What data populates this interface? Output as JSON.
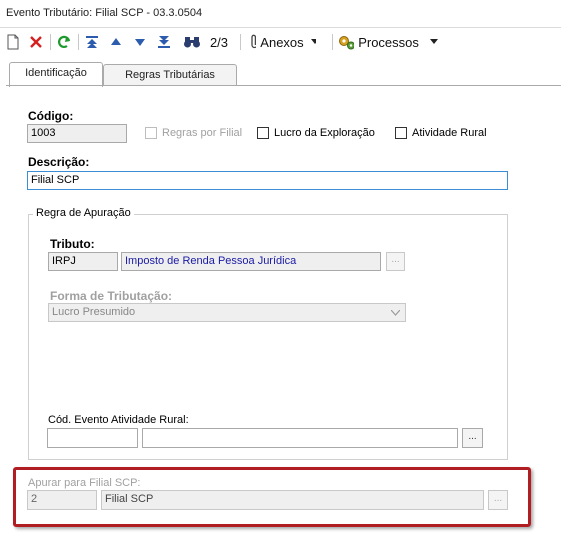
{
  "window": {
    "title": "Evento Tributário: Filial SCP - 03.3.0504"
  },
  "toolbar": {
    "record_position": "2/3",
    "anexos_label": "Anexos",
    "processos_label": "Processos"
  },
  "tabs": [
    {
      "label": "Identificação",
      "active": true
    },
    {
      "label": "Regras Tributárias",
      "active": false
    }
  ],
  "form": {
    "codigo_label": "Código:",
    "codigo_value": "1003",
    "regras_por_filial_label": "Regras por Filial",
    "lucro_exploracao_label": "Lucro da Exploração",
    "atividade_rural_label": "Atividade Rural",
    "descricao_label": "Descrição:",
    "descricao_value": "Filial SCP"
  },
  "regra_apuracao": {
    "group_label": "Regra de Apuração",
    "tributo_label": "Tributo:",
    "tributo_code": "IRPJ",
    "tributo_name": "Imposto de Renda Pessoa Jurídica",
    "forma_label": "Forma de Tributação:",
    "forma_value": "Lucro Presumido",
    "cod_evento_label": "Cód. Evento Atividade Rural:",
    "cod_evento_value": "",
    "cod_evento_desc": ""
  },
  "apurar_filial": {
    "label": "Apurar para Filial SCP:",
    "code": "2",
    "name": "Filial SCP"
  },
  "lookup_button_label": "...",
  "colors": {
    "highlight": "#b01e23",
    "focus": "#3b8dd4",
    "link_text": "#1a1aa6"
  }
}
